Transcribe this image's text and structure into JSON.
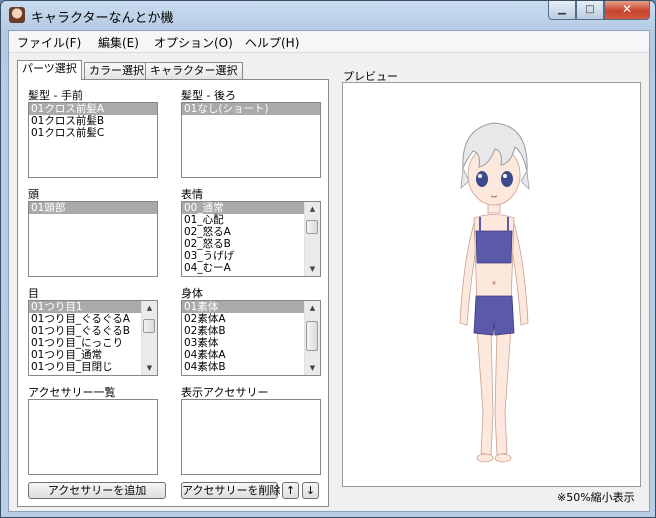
{
  "window": {
    "title": "キャラクターなんとか機"
  },
  "menu": [
    "ファイル(F)",
    "編集(E)",
    "オプション(O)",
    "ヘルプ(H)"
  ],
  "tabs": [
    "パーツ選択",
    "カラー選択",
    "キャラクター選択"
  ],
  "lists": {
    "hair_front": {
      "label": "髪型 - 手前",
      "items": [
        "01クロス前髪A",
        "01クロス前髪B",
        "01クロス前髪C"
      ],
      "selected": 0
    },
    "hair_back": {
      "label": "髪型 - 後ろ",
      "items": [
        "01なし(ショート)"
      ],
      "selected": 0
    },
    "head": {
      "label": "頭",
      "items": [
        "01頭部"
      ],
      "selected": 0
    },
    "expression": {
      "label": "表情",
      "items": [
        "00_通常",
        "01_心配",
        "02_怒るA",
        "02_怒るB",
        "03_うげげ",
        "04_むーA"
      ],
      "selected": 0
    },
    "eyes": {
      "label": "目",
      "items": [
        "01つり目1",
        "01つり目_ぐるぐるA",
        "01つり目_ぐるぐるB",
        "01つり目_にっこり",
        "01つり目_通常",
        "01つり目_目閉じ"
      ],
      "selected": 0
    },
    "body": {
      "label": "身体",
      "items": [
        "01素体",
        "02素体A",
        "02素体B",
        "03素体",
        "04素体A",
        "04素体B"
      ],
      "selected": 0
    },
    "accessory_all": {
      "label": "アクセサリー一覧",
      "items": []
    },
    "accessory_shown": {
      "label": "表示アクセサリー",
      "items": []
    }
  },
  "buttons": {
    "add": "アクセサリーを追加",
    "remove": "アクセサリーを削除",
    "up": "↑",
    "down": "↓",
    "move": "›"
  },
  "preview": {
    "label": "プレビュー",
    "note": "※50%縮小表示"
  },
  "colors": {
    "hair": "#e8e8ea",
    "skin": "#fce8dc",
    "swimsuit": "#5a5aa8",
    "eyes": "#3a4a8a"
  }
}
